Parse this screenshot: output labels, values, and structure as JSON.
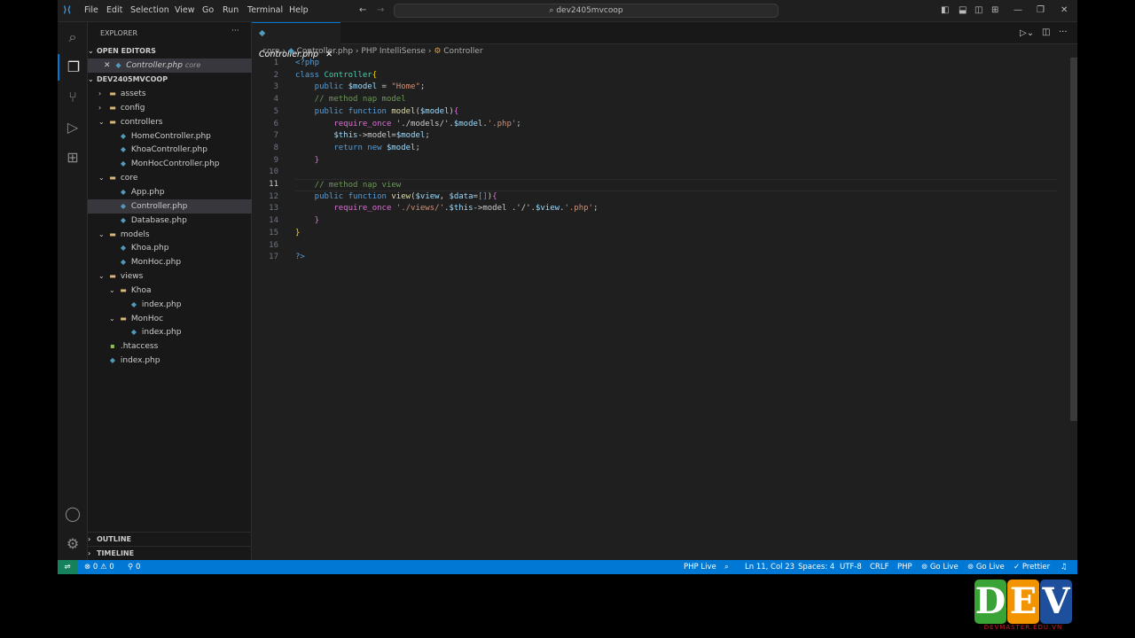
{
  "app": {
    "menus": [
      "File",
      "Edit",
      "Selection",
      "View",
      "Go",
      "Run",
      "Terminal",
      "Help"
    ],
    "search": "dev2405mvcoop"
  },
  "explorer": {
    "title": "EXPLORER",
    "open_editors": "OPEN EDITORS",
    "open_file": "Controller.php",
    "open_file_dir": "core",
    "project": "DEV2405MVCOOP",
    "tree": [
      {
        "name": "assets",
        "type": "folder",
        "depth": 0,
        "open": false
      },
      {
        "name": "config",
        "type": "folder",
        "depth": 0,
        "open": false
      },
      {
        "name": "controllers",
        "type": "folder",
        "depth": 0,
        "open": true
      },
      {
        "name": "HomeController.php",
        "type": "php",
        "depth": 1
      },
      {
        "name": "KhoaController.php",
        "type": "php",
        "depth": 1
      },
      {
        "name": "MonHocController.php",
        "type": "php",
        "depth": 1
      },
      {
        "name": "core",
        "type": "folder",
        "depth": 0,
        "open": true
      },
      {
        "name": "App.php",
        "type": "php",
        "depth": 1
      },
      {
        "name": "Controller.php",
        "type": "php",
        "depth": 1,
        "selected": true
      },
      {
        "name": "Database.php",
        "type": "php",
        "depth": 1
      },
      {
        "name": "models",
        "type": "folder",
        "depth": 0,
        "open": true
      },
      {
        "name": "Khoa.php",
        "type": "php",
        "depth": 1
      },
      {
        "name": "MonHoc.php",
        "type": "php",
        "depth": 1
      },
      {
        "name": "views",
        "type": "folder",
        "depth": 0,
        "open": true
      },
      {
        "name": "Khoa",
        "type": "folder",
        "depth": 1,
        "open": true
      },
      {
        "name": "index.php",
        "type": "php",
        "depth": 2
      },
      {
        "name": "MonHoc",
        "type": "folder",
        "depth": 1,
        "open": true
      },
      {
        "name": "index.php",
        "type": "php",
        "depth": 2
      },
      {
        "name": ".htaccess",
        "type": "file",
        "depth": 0
      },
      {
        "name": "index.php",
        "type": "php",
        "depth": 0
      }
    ],
    "outline": "OUTLINE",
    "timeline": "TIMELINE"
  },
  "editor": {
    "tab": "Controller.php",
    "breadcrumb": [
      "core",
      "Controller.php",
      "PHP IntelliSense",
      "Controller"
    ],
    "current_line": 11,
    "lines": [
      [
        [
          "<?php",
          "k"
        ]
      ],
      [
        [
          "class ",
          "k"
        ],
        [
          "Controller",
          "t"
        ],
        [
          "{",
          "b"
        ]
      ],
      [
        [
          "    public ",
          "k"
        ],
        [
          "$model",
          "v"
        ],
        [
          " = ",
          ""
        ],
        [
          "\"Home\"",
          "s"
        ],
        [
          ";",
          ""
        ]
      ],
      [
        [
          "    // method nạp model",
          "c"
        ]
      ],
      [
        [
          "    public function ",
          "k"
        ],
        [
          "model",
          "f"
        ],
        [
          "(",
          ""
        ],
        [
          "$model",
          "v"
        ],
        [
          ")",
          ""
        ],
        [
          "{",
          "p"
        ]
      ],
      [
        [
          "        require_once ",
          "p"
        ],
        [
          "'./models/'",
          ""
        ],
        [
          ".",
          ""
        ],
        [
          "$model",
          "v"
        ],
        [
          ".",
          ""
        ],
        [
          "'.php'",
          "s"
        ],
        [
          ";",
          ""
        ]
      ],
      [
        [
          "        $this",
          "v"
        ],
        [
          "->",
          ""
        ],
        [
          "model",
          ""
        ],
        [
          "=",
          ""
        ],
        [
          "$model",
          "v"
        ],
        [
          ";",
          ""
        ]
      ],
      [
        [
          "        return new ",
          "k"
        ],
        [
          "$model",
          "v"
        ],
        [
          ";",
          ""
        ]
      ],
      [
        [
          "    }",
          "p"
        ]
      ],
      [
        [
          "",
          ""
        ]
      ],
      [
        [
          "    // method nạp view",
          "c"
        ]
      ],
      [
        [
          "    public function ",
          "k"
        ],
        [
          "view",
          "f"
        ],
        [
          "(",
          ""
        ],
        [
          "$view",
          "v"
        ],
        [
          ", ",
          ""
        ],
        [
          "$data",
          "v"
        ],
        [
          "=",
          ""
        ],
        [
          "[]",
          "k"
        ],
        [
          ")",
          ""
        ],
        [
          "{",
          "p"
        ]
      ],
      [
        [
          "        require_once ",
          "p"
        ],
        [
          "'./views/'",
          "s"
        ],
        [
          ".",
          ""
        ],
        [
          "$this",
          "v"
        ],
        [
          "->",
          ""
        ],
        [
          "model ",
          ""
        ],
        [
          ".'/'.",
          ""
        ],
        [
          "$view",
          "v"
        ],
        [
          ".",
          ""
        ],
        [
          "'.php'",
          "s"
        ],
        [
          ";",
          ""
        ]
      ],
      [
        [
          "    }",
          "p"
        ]
      ],
      [
        [
          "}",
          "b"
        ]
      ],
      [
        [
          "",
          ""
        ]
      ],
      [
        [
          "?>",
          "k"
        ]
      ]
    ]
  },
  "status": {
    "errors": "0",
    "warnings": "0",
    "ports": "0",
    "php_live": "PHP Live",
    "position": "Ln 11, Col 23",
    "spaces": "Spaces: 4",
    "encoding": "UTF-8",
    "eol": "CRLF",
    "language": "PHP",
    "golive1": "Go Live",
    "golive2": "Go Live",
    "prettier": "Prettier"
  },
  "logo": {
    "letters": [
      "D",
      "E",
      "V"
    ],
    "colors": [
      "#3aa335",
      "#f29300",
      "#1d4f9c"
    ],
    "sub": "DEVMASTER.EDU.VN"
  }
}
